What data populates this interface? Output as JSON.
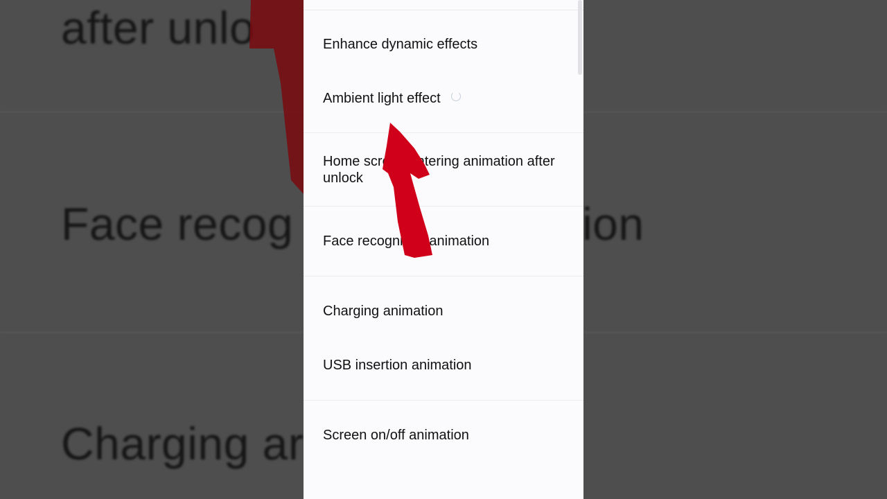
{
  "background": {
    "lines": [
      "after unlo",
      "Face recog",
      "ion",
      "Charging ar"
    ]
  },
  "settings": {
    "items": [
      {
        "label": "Enhance dynamic effects"
      },
      {
        "label": "Ambient light effect"
      },
      {
        "label": "Home screen entering animation after unlock"
      },
      {
        "label": "Face recognition animation"
      },
      {
        "label": "Charging animation"
      },
      {
        "label": "USB insertion animation"
      },
      {
        "label": "Screen on/off animation"
      }
    ]
  },
  "overlay": {
    "arrow_color": "#d0001b",
    "arrow_direction": "up"
  },
  "colors": {
    "panel_bg": "#fbfafc",
    "backdrop": "#4e4e4e",
    "text": "#111111"
  }
}
